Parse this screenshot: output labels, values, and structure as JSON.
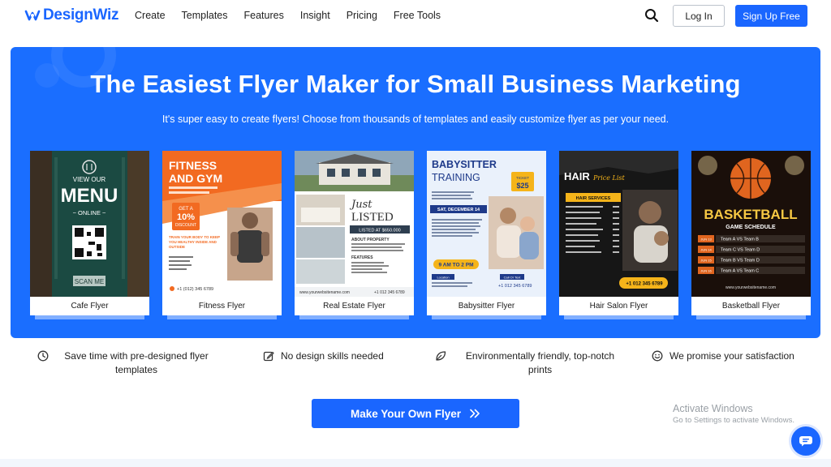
{
  "nav": {
    "logo_text": "DesignWiz",
    "links": [
      "Create",
      "Templates",
      "Features",
      "Insight",
      "Pricing",
      "Free Tools"
    ],
    "login_label": "Log In",
    "signup_label": "Sign Up Free",
    "search_icon": "search-icon"
  },
  "hero": {
    "title": "The Easiest Flyer Maker for Small Business Marketing",
    "subtitle": "It's super easy to create flyers! Choose from thousands of templates and easily customize flyer as per your need."
  },
  "cards": [
    {
      "label": "Cafe Flyer",
      "text": {
        "line1": "VIEW OUR",
        "line2": "MENU",
        "line3": "~ ONLINE ~",
        "line4": "SCAN ME"
      }
    },
    {
      "label": "Fitness Flyer",
      "text": {
        "line1": "FITNESS",
        "line2": "AND GYM",
        "badge1": "GET A",
        "badge2": "10%",
        "badge3": "DISCOUNT",
        "line3": "TRAIN YOUR BODY TO KEEP YOU HEALTHY INSIDE AND OUTSIDE",
        "phone": "+1 (012) 345 6789"
      }
    },
    {
      "label": "Real Estate Flyer",
      "text": {
        "line1": "Just",
        "line2": "LISTED",
        "price": "LISTED AT $650.000",
        "line3": "ABOUT PROPERTY",
        "line4": "FEATURES",
        "web": "www.yourwebsitename.com",
        "phone": "+1 012 345 6789"
      }
    },
    {
      "label": "Babysitter Flyer",
      "text": {
        "line1": "BABYSITTER",
        "line2": "TRAINING",
        "ticket1": "TICKET",
        "ticket2": "$25",
        "date": "SAT, DECEMBER 14",
        "time": "9 AM TO 2 PM",
        "loc": "Location",
        "call": "Call Or Text",
        "phone": "+1 012 345 6789"
      }
    },
    {
      "label": "Hair Salon Flyer",
      "text": {
        "line1": "HAIR",
        "line2": "Price List",
        "line3": "HAIR SERVICES",
        "phone": "+1 012 345 6789"
      }
    },
    {
      "label": "Basketball Flyer",
      "text": {
        "line1": "BASKETBALL",
        "line2": "GAME SCHEDULE",
        "row1": "Team A VS Team B",
        "row2": "Team C VS Team D",
        "row3": "Team B VS Team D",
        "row4": "Team A VS Team C",
        "d1": "JUN 13",
        "d2": "JUN 14",
        "d3": "JUN 15",
        "d4": "JUN 16",
        "web": "www.yourwebsitename.com"
      }
    }
  ],
  "features": [
    {
      "icon": "clock-icon",
      "label": "Save time with pre-designed flyer templates"
    },
    {
      "icon": "edit-icon",
      "label": "No design skills needed"
    },
    {
      "icon": "leaf-icon",
      "label": "Environmentally friendly, top-notch prints"
    },
    {
      "icon": "smile-icon",
      "label": "We promise your satisfaction"
    }
  ],
  "cta_label": "Make Your Own Flyer",
  "watermark": {
    "line1": "Activate Windows",
    "line2": "Go to Settings to activate Windows."
  },
  "colors": {
    "brand_blue": "#1a66ff",
    "hero_blue": "#1a6eff"
  }
}
